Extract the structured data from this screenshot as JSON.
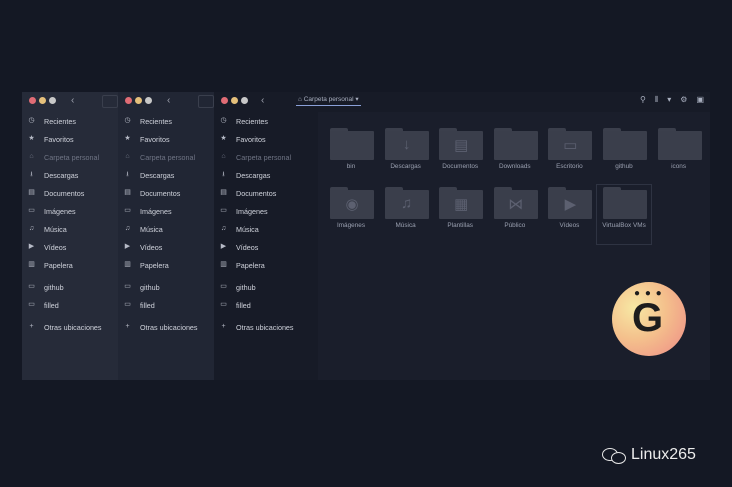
{
  "sidebar": {
    "places": [
      {
        "label": "Recientes",
        "icon": "clock-icon",
        "glyph": "◷"
      },
      {
        "label": "Favoritos",
        "icon": "star-icon",
        "glyph": "★"
      },
      {
        "label": "Carpeta personal",
        "icon": "home-icon",
        "glyph": "⌂",
        "dim": true
      },
      {
        "label": "Descargas",
        "icon": "download-icon",
        "glyph": "⭳"
      },
      {
        "label": "Documentos",
        "icon": "document-icon",
        "glyph": "▤"
      },
      {
        "label": "Imágenes",
        "icon": "image-icon",
        "glyph": "▭"
      },
      {
        "label": "Música",
        "icon": "music-icon",
        "glyph": "♫"
      },
      {
        "label": "Vídeos",
        "icon": "video-icon",
        "glyph": "▶"
      },
      {
        "label": "Papelera",
        "icon": "trash-icon",
        "glyph": "▥"
      }
    ],
    "bookmarks": [
      {
        "label": "github",
        "icon": "folder-icon",
        "glyph": "▭"
      },
      {
        "label": "filled",
        "icon": "folder-icon",
        "glyph": "▭"
      }
    ],
    "other": {
      "label": "Otras ubicaciones",
      "icon": "plus-icon",
      "glyph": "+"
    }
  },
  "header": {
    "path_label": "Carpeta personal",
    "tools": [
      {
        "icon": "search-icon",
        "glyph": "⚲"
      },
      {
        "icon": "view-list-icon",
        "glyph": "⫴"
      },
      {
        "icon": "chevron-down-icon",
        "glyph": "▾"
      },
      {
        "icon": "gear-icon",
        "glyph": "⚙"
      },
      {
        "icon": "menu-icon",
        "glyph": "▣"
      }
    ]
  },
  "folders": [
    {
      "name": "bin",
      "glyph": ""
    },
    {
      "name": "Descargas",
      "glyph": "↓"
    },
    {
      "name": "Documentos",
      "glyph": "▤"
    },
    {
      "name": "Downloads",
      "glyph": ""
    },
    {
      "name": "Escritorio",
      "glyph": "▭"
    },
    {
      "name": "github",
      "glyph": ""
    },
    {
      "name": "icons",
      "glyph": ""
    },
    {
      "name": "Imágenes",
      "glyph": "◉"
    },
    {
      "name": "Música",
      "glyph": "♫"
    },
    {
      "name": "Plantillas",
      "glyph": "▦"
    },
    {
      "name": "Público",
      "glyph": "⋈"
    },
    {
      "name": "Vídeos",
      "glyph": "▶"
    },
    {
      "name": "VirtualBox VMs",
      "glyph": ""
    }
  ],
  "brand": {
    "text": "Linux265"
  },
  "colors": {
    "background": "#141824",
    "sidebar": "#262b39",
    "accent": "#8aa0d8"
  }
}
